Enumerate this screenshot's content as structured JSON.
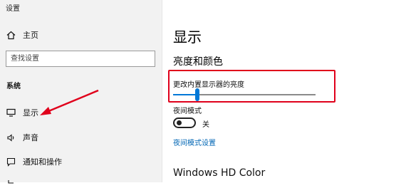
{
  "window": {
    "title": "设置"
  },
  "sidebar": {
    "home_label": "主页",
    "search_placeholder": "查找设置",
    "section_label": "系统",
    "items": [
      {
        "label": "显示",
        "icon": "monitor-icon"
      },
      {
        "label": "声音",
        "icon": "speaker-icon"
      },
      {
        "label": "通知和操作",
        "icon": "notification-icon"
      }
    ]
  },
  "main": {
    "title": "显示",
    "subtitle": "亮度和颜色",
    "brightness_label": "更改内置显示器的亮度",
    "brightness_level": 0.17,
    "night_mode_label": "夜间模式",
    "night_mode_state": "关",
    "night_mode_link": "夜间模式设置",
    "hd_color_title": "Windows HD Color"
  },
  "colors": {
    "accent": "#0078d7",
    "highlight": "#e0001b",
    "link": "#0066b4"
  }
}
